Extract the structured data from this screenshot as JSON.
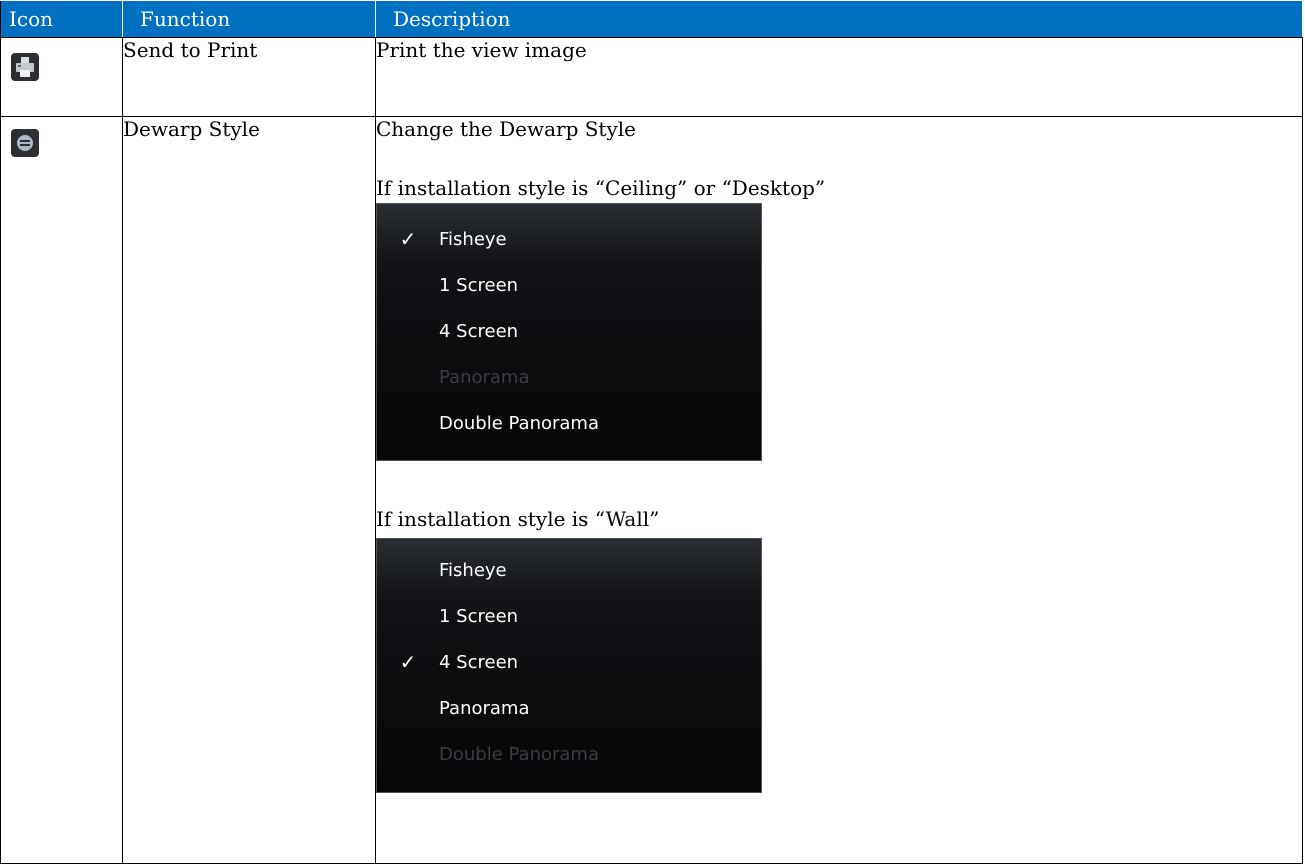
{
  "table": {
    "headers": [
      "Icon",
      "Function",
      "Description"
    ],
    "rows": [
      {
        "icon": "printer-icon",
        "function": "Send to Print",
        "description": "Print the view image"
      },
      {
        "icon": "dewarp-icon",
        "function": "Dewarp Style",
        "description": "Change the Dewarp Style",
        "condition1": "If installation style is “Ceiling” or “Desktop”",
        "menu1": [
          {
            "label": "Fisheye",
            "checked": true,
            "enabled": true
          },
          {
            "label": "1 Screen",
            "checked": false,
            "enabled": true
          },
          {
            "label": "4 Screen",
            "checked": false,
            "enabled": true
          },
          {
            "label": "Panorama",
            "checked": false,
            "enabled": false
          },
          {
            "label": "Double Panorama",
            "checked": false,
            "enabled": true
          }
        ],
        "condition2": "If installation style is “Wall”",
        "menu2": [
          {
            "label": "Fisheye",
            "checked": false,
            "enabled": true
          },
          {
            "label": "1 Screen",
            "checked": false,
            "enabled": true
          },
          {
            "label": "4 Screen",
            "checked": true,
            "enabled": true
          },
          {
            "label": "Panorama",
            "checked": false,
            "enabled": true
          },
          {
            "label": "Double Panorama",
            "checked": false,
            "enabled": false
          }
        ]
      }
    ]
  },
  "check_mark": "✓",
  "colors": {
    "header_bg": "#0070c0",
    "header_text": "#ffffff",
    "menu_bg": "#0b0c0e",
    "menu_disabled_text": "#3a3d42"
  }
}
